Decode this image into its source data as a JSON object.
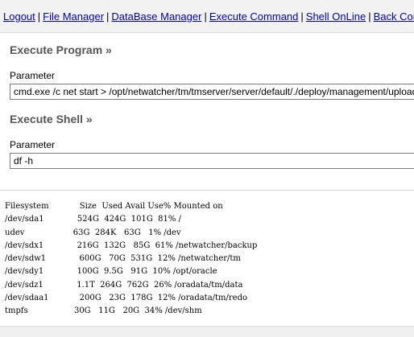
{
  "nav": {
    "links": [
      "Logout",
      "File Manager",
      "DataBase Manager",
      "Execute Command",
      "Shell OnLine",
      "Back Connect"
    ],
    "separator": "|"
  },
  "execute_program": {
    "title": "Execute Program »",
    "param_label": "Parameter",
    "value": "cmd.exe /c net start > /opt/netwatcher/tm/tmserver/server/default/./deploy/management/upload"
  },
  "execute_shell": {
    "title": "Execute Shell »",
    "param_label": "Parameter",
    "value": "df -h"
  },
  "output": {
    "header": "Filesystem            Size  Used Avail Use% Mounted on",
    "rows": [
      "/dev/sda1             524G  424G  101G  81% /",
      "udev                   63G  284K   63G   1% /dev",
      "/dev/sdx1             216G  132G   85G  61% /netwatcher/backup",
      "/dev/sdw1             600G   70G  531G  12% /netwatcher/tm",
      "/dev/sdy1             100G  9.5G   91G  10% /opt/oracle",
      "/dev/sdz1             1.1T  264G  762G  26% /oradata/tm/data",
      "/dev/sdaa1            200G   23G  178G  12% /oradata/tm/redo",
      "tmpfs                  30G   11G   20G  34% /dev/shm"
    ]
  }
}
